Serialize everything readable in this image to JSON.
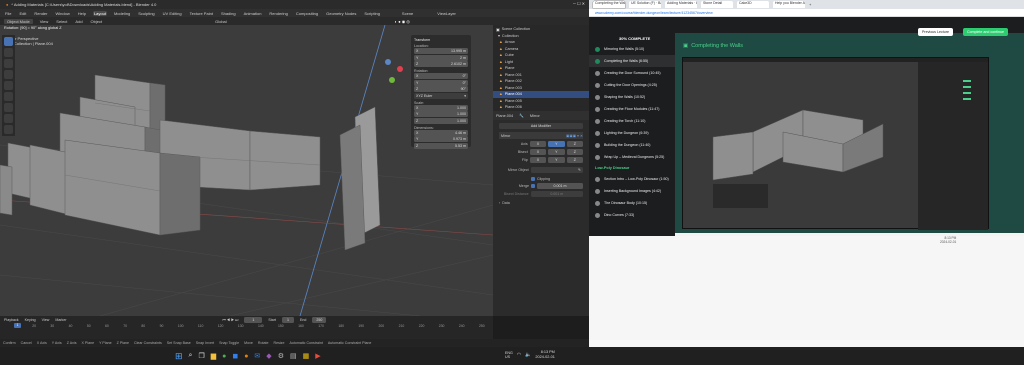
{
  "left": {
    "window_title": "* Adding Materials [C:\\Users\\yoll\\Downloads\\Adding Materials.blend] - Blender 4.0",
    "menus": [
      "File",
      "Edit",
      "Render",
      "Window",
      "Help"
    ],
    "workspace_tabs": [
      "Layout",
      "Modeling",
      "Sculpting",
      "UV Editing",
      "Texture Paint",
      "Shading",
      "Animation",
      "Rendering",
      "Compositing",
      "Geometry Nodes",
      "Scripting"
    ],
    "active_tab": "Layout",
    "scene_label": "Scene",
    "viewlayer_label": "ViewLayer",
    "header": {
      "mode": "Object Mode",
      "view": "View",
      "select": "Select",
      "add": "Add",
      "object": "Object",
      "orientation": "Global"
    },
    "operator_hint": "Rotation: [90] = 90° along global Z",
    "viewport_info": {
      "line1": "User Perspective",
      "line2": "(1) Collection | Plane.004"
    },
    "npanel": {
      "title": "Transform",
      "location_label": "Location:",
      "location": {
        "x": "13.995 m",
        "y": "2 m",
        "z": "2.6102 m"
      },
      "rotation_label": "Rotation:",
      "rotation": {
        "x": "0°",
        "y": "0°",
        "z": "90°"
      },
      "rotation_mode": "XYZ Euler",
      "scale_label": "Scale:",
      "scale": {
        "x": "1.000",
        "y": "1.000",
        "z": "1.000"
      },
      "dimensions_label": "Dimensions:",
      "dimensions": {
        "x": "4.46 m",
        "y": "0.973 m",
        "z": "5.53 m"
      }
    },
    "outliner": {
      "root": "Scene Collection",
      "collection": "Collection",
      "items": [
        "Arrow",
        "Camera",
        "Cube",
        "Light",
        "Plane",
        "Plane.001",
        "Plane.002",
        "Plane.003",
        "Plane.004",
        "Plane.005",
        "Plane.006"
      ],
      "selected": "Plane.004",
      "pillars": "pillars"
    },
    "properties": {
      "object": "Plane.004",
      "modifier_type": "Mirror",
      "add_modifier": "Add Modifier",
      "modifier_name": "Mirror",
      "axis_label": "Axis",
      "bisect_label": "Bisect",
      "flip_label": "Flip",
      "axes": [
        "X",
        "Y",
        "Z"
      ],
      "mirror_object_label": "Mirror Object",
      "clipping_label": "Clipping",
      "merge_label": "Merge",
      "merge_value": "0.001 m",
      "bisect_distance_label": "Bisect Distance",
      "bisect_distance_value": "0.001 m",
      "data_label": "Data"
    },
    "timeline": {
      "playback": "Playback",
      "keying": "Keying",
      "view": "View",
      "marker": "Marker",
      "current_frame": "1",
      "start_label": "Start",
      "start": "1",
      "end_label": "End",
      "end": "250",
      "ticks": [
        "10",
        "20",
        "30",
        "40",
        "50",
        "60",
        "70",
        "80",
        "90",
        "100",
        "110",
        "120",
        "130",
        "140",
        "150",
        "160",
        "170",
        "180",
        "190",
        "200",
        "210",
        "220",
        "230",
        "240",
        "250"
      ]
    },
    "statusbar": [
      "Confirm",
      "Cancel",
      "X Axis",
      "Y Axis",
      "Z Axis",
      "X Plane",
      "Y Plane",
      "Z Plane",
      "Clear Constraints",
      "Set Snap Base",
      "Snap Invert",
      "Snap Toggle",
      "Move",
      "Rotate",
      "Resize",
      "Automatic Constraint",
      "Automatic Constraint Plane"
    ]
  },
  "taskbar": {
    "lang1": "ENG",
    "lang2": "US",
    "time": "8:13 PM",
    "date": "2024-02-01"
  },
  "right": {
    "tabs": [
      "Completing the Walls | Udemy",
      "UE Solution (F) · Bake map",
      "Adding Materials · Blender",
      "Stone Detail",
      "Cake3D",
      "Help you Blender Add-on"
    ],
    "url": "www.udemy.com/course/blender-dungeon/learn/lecture/41234567#overview",
    "progress_text": "30% COMPLETE",
    "lecture_title": "Completing the Walls",
    "prev_button": "Previous Lecture",
    "next_button": "Complete and continue",
    "lectures": [
      {
        "label": "Mirroring the Walls (5:10)",
        "done": true
      },
      {
        "label": "Completing the Walls (6:55)",
        "done": true,
        "active": true
      },
      {
        "label": "Creating the Door Surround (10:45)",
        "done": false
      },
      {
        "label": "Cutting the Door Openings (4:25)",
        "done": false
      },
      {
        "label": "Shaping the Walls (10:52)",
        "done": false
      },
      {
        "label": "Creating the Floor Modules (11:47)",
        "done": false
      },
      {
        "label": "Creating the Torch (11:10)",
        "done": false
      },
      {
        "label": "Lighting the Dungeon (6:39)",
        "done": false
      },
      {
        "label": "Building the Dungeon (11:40)",
        "done": false
      },
      {
        "label": "Wrap Up – Medieval Dungeons (5:25)",
        "done": false
      }
    ],
    "section2": "Low-Poly Dinosaur",
    "lectures2": [
      {
        "label": "Section Intro – Low-Poly Dinosaur (1:50)",
        "done": false
      },
      {
        "label": "Inserting Background Images (4:42)",
        "done": false
      },
      {
        "label": "The Dinosaur Body (10:15)",
        "done": false
      },
      {
        "label": "Dino Curves (7:33)",
        "done": false
      }
    ]
  },
  "colors": {
    "blender_accent": "#4772b3",
    "udemy_green": "#1f8a5b",
    "udemy_bg": "#1c1d1f",
    "selection": "#334d80"
  }
}
